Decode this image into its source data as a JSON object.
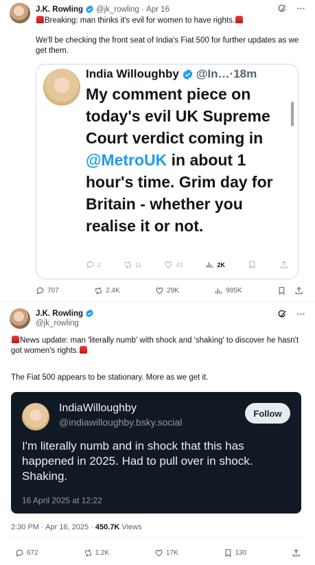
{
  "tweet1": {
    "author_name": "J.K. Rowling",
    "handle": "@jk_rowling",
    "date": "Apr 16",
    "line1": "Breaking: man thinks it's evil for women to have rights.",
    "line2": "We'll be checking the front seat of India's Fiat 500 for further updates as we get them.",
    "quote": {
      "author_name": "India Willoughby",
      "handle": "@In…",
      "time": "18m",
      "text_before": "My comment piece on today's evil UK Supreme Court verdict coming in ",
      "mention": "@MetroUK",
      "text_after": " in about 1 hour's time. Grim day for Britain - whether you realise it or not.",
      "replies": "2",
      "reposts": "11",
      "likes": "43",
      "views": "2K"
    },
    "replies": "707",
    "reposts": "2.4K",
    "likes": "29K",
    "views": "995K"
  },
  "tweet2": {
    "author_name": "J.K. Rowling",
    "handle": "@jk_rowling",
    "line1": "News update: man 'literally numb' with shock and 'shaking' to discover he hasn't got women's rights.",
    "line2": "The Fiat 500 appears to be stationary. More as we get it.",
    "card": {
      "name": "IndiaWilloughby",
      "handle": "@indiawilloughby.bsky.social",
      "follow_label": "Follow",
      "text": "I'm literally numb and in shock that this has happened in 2025. Had to pull over in shock. Shaking.",
      "date": "16 April 2025 at 12:22"
    },
    "timestamp": "2:30 PM · Apr 16, 2025 · ",
    "views_count": "450.7K",
    "views_label": " Views",
    "replies": "672",
    "reposts": "1.2K",
    "likes": "17K",
    "bookmarks": "130"
  },
  "colors": {
    "accent": "#1d9bf0",
    "siren": "#e0245e",
    "card_bg": "#111a24"
  },
  "icons": [
    "verified-badge-icon",
    "grok-icon",
    "more-icon",
    "reply-icon",
    "repost-icon",
    "like-icon",
    "views-icon",
    "bookmark-icon",
    "share-icon",
    "siren-emoji-icon"
  ]
}
